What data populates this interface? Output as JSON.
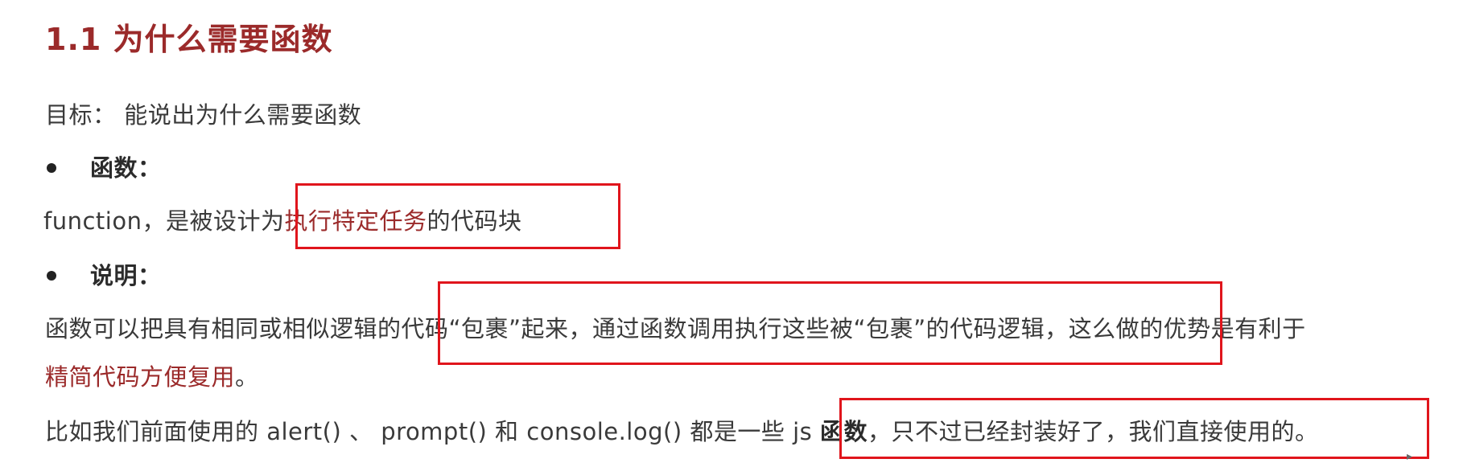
{
  "title": "1.1 为什么需要函数",
  "goal": "目标：  能说出为什么需要函数",
  "bullet1": {
    "label": "函数："
  },
  "definition": {
    "prefix": "function，是被设计为",
    "highlight": "执行特定任务",
    "suffix": "的代码块"
  },
  "bullet2": {
    "label": "说明："
  },
  "explanation": {
    "line1": "函数可以把具有相同或相似逻辑的代码“包裹”起来，通过函数调用执行这些被“包裹”的代码逻辑，这么做的优势是有利于",
    "line2_highlight": "精简代码方便复用",
    "line2_end": "。"
  },
  "example": {
    "prefix": "比如我们前面使用的 alert() 、 prompt() 和 console.log()   都是一些 js ",
    "bold": "函数",
    "suffix": "，只不过已经封装好了，我们直接使用的。"
  },
  "colors": {
    "title": "#9b2a2a",
    "highlight": "#9b2a2a",
    "box": "#e0151c"
  }
}
